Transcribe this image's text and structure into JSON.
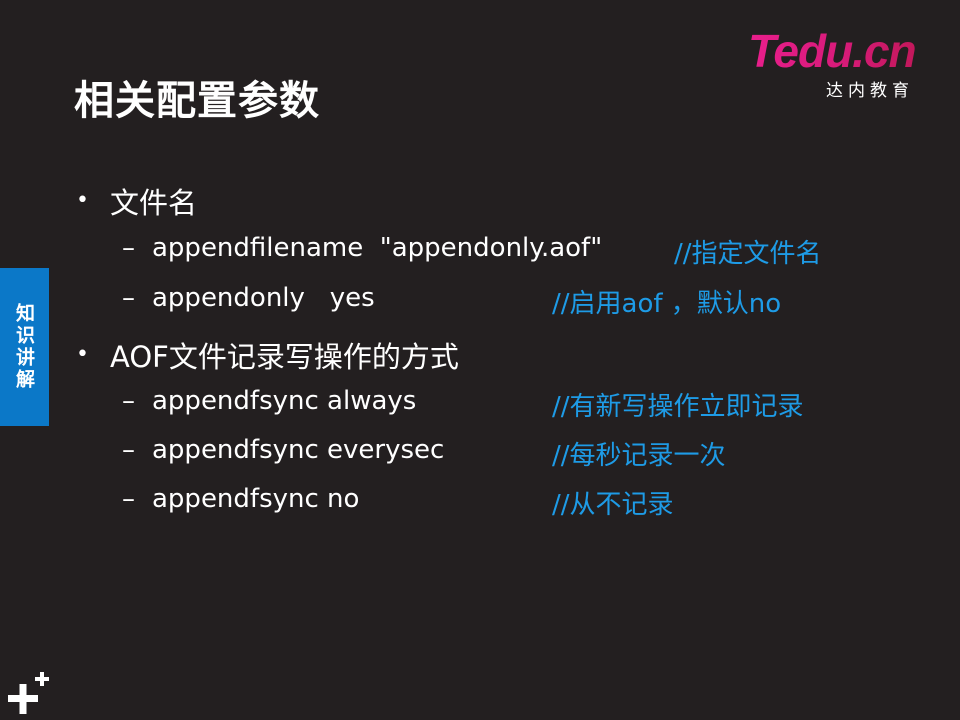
{
  "slide": {
    "title": "相关配置参数",
    "logo": {
      "main": "Tedu.cn",
      "sub": "达内教育"
    },
    "side_tab": "知识讲解",
    "sections": [
      {
        "bullet": "•",
        "heading": "文件名",
        "items": [
          {
            "dash": "–",
            "code": "appendfilename  \"appendonly.aof\"",
            "comment": "//指定文件名"
          },
          {
            "dash": "–",
            "code": "appendonly   yes",
            "comment": "//启用aof ，默认no"
          }
        ]
      },
      {
        "bullet": "•",
        "heading": "AOF文件记录写操作的方式",
        "items": [
          {
            "dash": "–",
            "code": "appendfsync always",
            "comment": "//有新写操作立即记录"
          },
          {
            "dash": "–",
            "code": "appendfsync everysec",
            "comment": "//每秒记录一次"
          },
          {
            "dash": "–",
            "code": "appendfsync no",
            "comment": "//从不记录"
          }
        ]
      }
    ],
    "colors": {
      "background": "#231f20",
      "accent_blue": "#0b78c8",
      "comment_blue": "#1e9be6",
      "logo_pink": "#e91e8c"
    },
    "icons": {
      "corner": "plus-icon"
    }
  }
}
